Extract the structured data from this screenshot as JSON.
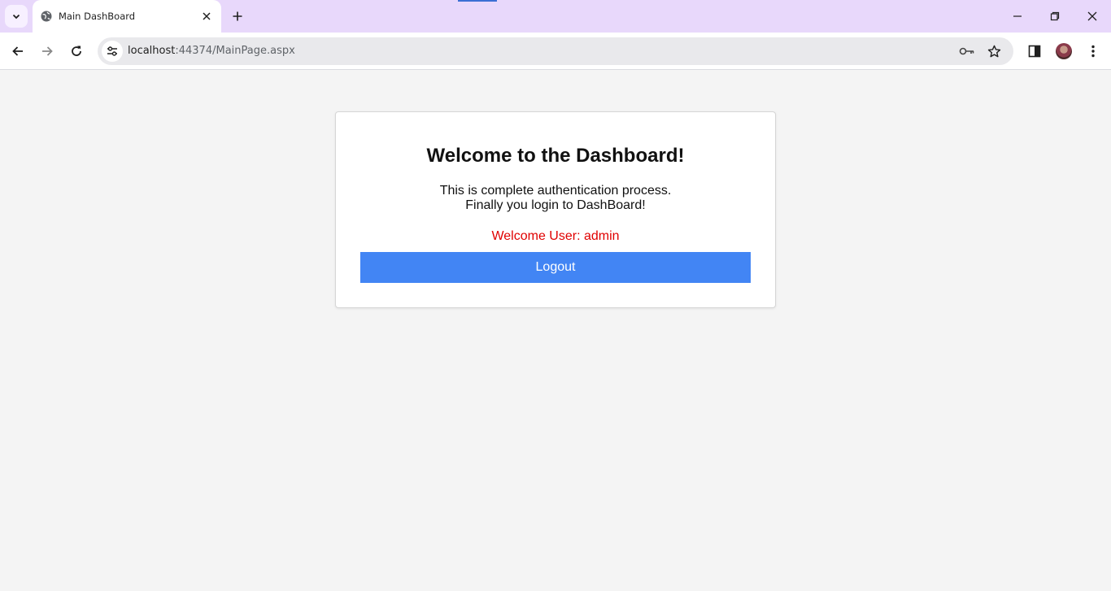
{
  "browser": {
    "tab": {
      "title": "Main DashBoard"
    },
    "omnibox": {
      "host": "localhost",
      "path": ":44374/MainPage.aspx"
    },
    "icons": {
      "tab_search": "chevron-down-icon",
      "favicon": "globe-icon",
      "tab_close": "close-icon",
      "new_tab": "plus-icon",
      "minimize": "minimize-icon",
      "restore": "restore-icon",
      "close_window": "close-icon",
      "back": "arrow-left-icon",
      "forward": "arrow-right-icon",
      "reload": "reload-icon",
      "site_info": "tune-icon",
      "password": "key-icon",
      "bookmark": "star-icon",
      "side_panel": "side-panel-icon",
      "menu": "kebab-menu-icon"
    },
    "colors": {
      "tabstrip": "#e8d8fb",
      "omnibox": "#e9e9ec"
    }
  },
  "page": {
    "heading": "Welcome to the Dashboard!",
    "message_line1": "This is complete authentication process.",
    "message_line2": "Finally you login to DashBoard!",
    "welcome_user": "Welcome User: admin",
    "logout_label": "Logout",
    "colors": {
      "button": "#4285f4",
      "welcome_text": "#e00000",
      "background": "#f4f4f4"
    }
  }
}
